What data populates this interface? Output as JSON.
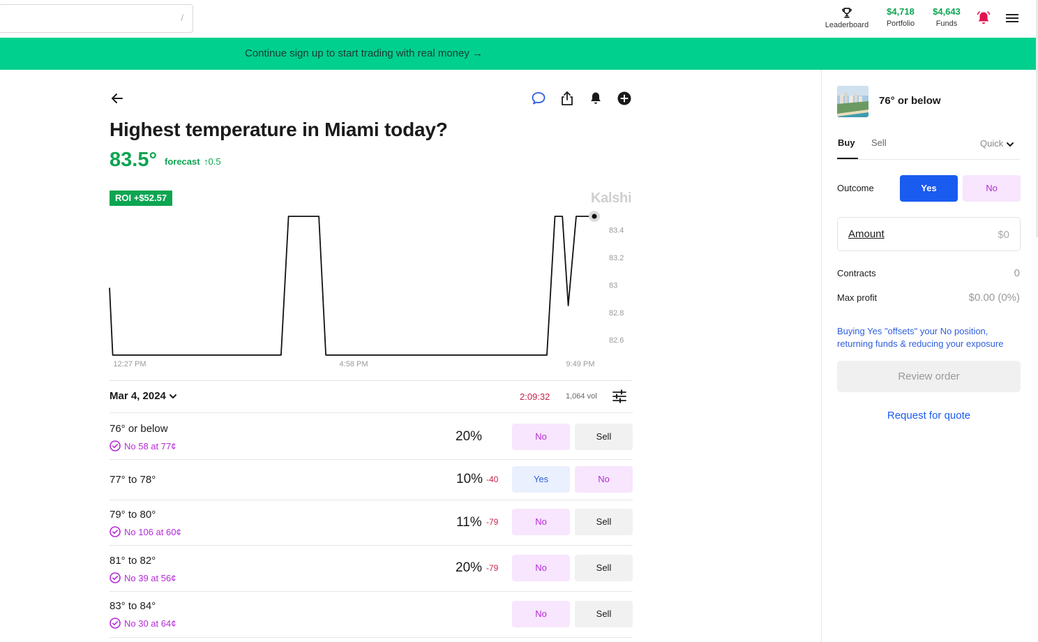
{
  "header": {
    "search_shortcut": "/",
    "leaderboard_label": "Leaderboard",
    "portfolio_value": "$4,718",
    "portfolio_label": "Portfolio",
    "funds_value": "$4,643",
    "funds_label": "Funds"
  },
  "banner": {
    "text": "Continue sign up to start trading with real money →"
  },
  "market": {
    "title": "Highest temperature in Miami today?",
    "forecast_value": "83.5°",
    "forecast_label": "forecast",
    "forecast_change": "↑0.5",
    "roi_badge": "ROI +$52.57",
    "brand": "Kalshi",
    "date": "Mar 4, 2024",
    "timer": "2:09:32",
    "volume": "1,064 vol"
  },
  "chart_data": {
    "type": "line",
    "x_ticks": [
      "12:27 PM",
      "4:58 PM",
      "9:49 PM"
    ],
    "y_ticks": [
      83.4,
      83.2,
      83,
      82.8,
      82.6
    ],
    "ylim": [
      82.55,
      83.5
    ],
    "series": [
      {
        "values": [
          [
            0.0,
            82.98
          ],
          [
            0.6,
            82.49
          ],
          [
            32.2,
            82.49
          ],
          [
            33.6,
            83.5
          ],
          [
            39.3,
            83.5
          ],
          [
            40.6,
            82.49
          ],
          [
            82.1,
            82.49
          ],
          [
            83.6,
            83.5
          ],
          [
            85.0,
            83.5
          ],
          [
            86.1,
            82.85
          ],
          [
            87.6,
            83.5
          ],
          [
            91.0,
            83.5
          ]
        ]
      }
    ],
    "grid": false,
    "legend": "none"
  },
  "outcomes": [
    {
      "label": "76° or below",
      "position": "No 58 at 77¢",
      "chance": "20%",
      "delta": "",
      "buttons": [
        "No",
        "Sell"
      ]
    },
    {
      "label": "77° to 78°",
      "position": "",
      "chance": "10%",
      "delta": "-40",
      "buttons": [
        "Yes",
        "No"
      ]
    },
    {
      "label": "79° to 80°",
      "position": "No 106 at 60¢",
      "chance": "11%",
      "delta": "-79",
      "buttons": [
        "No",
        "Sell"
      ]
    },
    {
      "label": "81° to 82°",
      "position": "No 39 at 56¢",
      "chance": "20%",
      "delta": "-79",
      "buttons": [
        "No",
        "Sell"
      ]
    },
    {
      "label": "83° to 84°",
      "position": "No 30 at 64¢",
      "chance": "",
      "delta": "",
      "buttons": [
        "No",
        "Sell"
      ]
    }
  ],
  "order_panel": {
    "title": "76° or below",
    "tab_buy": "Buy",
    "tab_sell": "Sell",
    "mode": "Quick",
    "outcome_label": "Outcome",
    "yes_label": "Yes",
    "no_label": "No",
    "amount_label": "Amount",
    "amount_value": "$0",
    "contracts_label": "Contracts",
    "contracts_value": "0",
    "max_profit_label": "Max profit",
    "max_profit_value": "$0.00 (0%)",
    "note": "Buying Yes \"offsets\" your No position, returning funds & reducing your exposure",
    "review_label": "Review order",
    "rfq_label": "Request for quote"
  },
  "colors": {
    "accent_green": "#0ca551",
    "banner_green": "#00d08e",
    "no_purple": "#b62ad8",
    "yes_blue": "#1a5bf0",
    "negative_red": "#c8234b"
  }
}
